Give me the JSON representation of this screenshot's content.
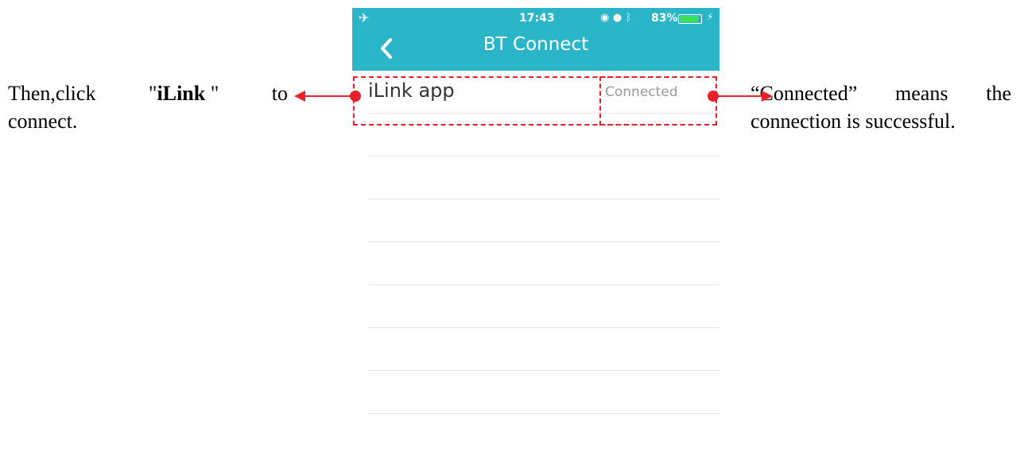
{
  "annotations": {
    "left": {
      "word1": "Then,click",
      "quote_open": "\"",
      "bold": "iLink",
      "quote_close": " \"",
      "word_to": "to",
      "line2": "connect."
    },
    "right": {
      "word1": "“Connected”",
      "word2": "means",
      "word3": "the",
      "line2": "connection is successful."
    }
  },
  "status_bar": {
    "time": "17:43",
    "battery": "83%",
    "battery_level": 0.83
  },
  "header": {
    "title": "BT Connect"
  },
  "devices": [
    {
      "name": "iLink app",
      "status": "Connected"
    }
  ],
  "colors": {
    "header": "#2ab5c8",
    "annotation": "#e8202a",
    "battery_fill": "#3ee05a"
  }
}
